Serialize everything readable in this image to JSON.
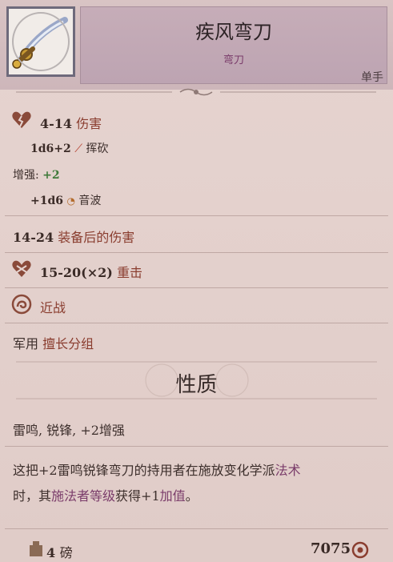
{
  "item": {
    "name": "疾风弯刀",
    "type": "弯刀",
    "handedness": "单手",
    "icon": "scimitar-icon"
  },
  "damage": {
    "range": "4-14",
    "label": "伤害",
    "dice": "1d6+2",
    "damage_type": "挥砍",
    "enhance_label": "增强:",
    "enhance_value": "+2",
    "bonus_dice": "+1d6",
    "bonus_type": "音波"
  },
  "equipped": {
    "range": "14-24",
    "label": "装备后的伤害"
  },
  "critical": {
    "range": "15-20(×2)",
    "label": "重击"
  },
  "attack_type": "近战",
  "proficiency": {
    "label": "军用",
    "group": "擅长分组"
  },
  "properties_section": "性质",
  "properties": "雷鸣, 锐锋, +2增强",
  "description": {
    "part1": "这把+2雷鸣锐锋弯刀的持用者在施放变化学派",
    "link1": "法术",
    "part2": "时，其",
    "link2": "施法者等级",
    "part3": "获得+1",
    "link3": "加值",
    "part4": "。"
  },
  "footer": {
    "weight_value": "4",
    "weight_unit": "磅",
    "price": "7075"
  },
  "colors": {
    "accent_red": "#8a3d2f",
    "enhance_green": "#3f7a3a",
    "link_purple": "#7a3c6a"
  }
}
